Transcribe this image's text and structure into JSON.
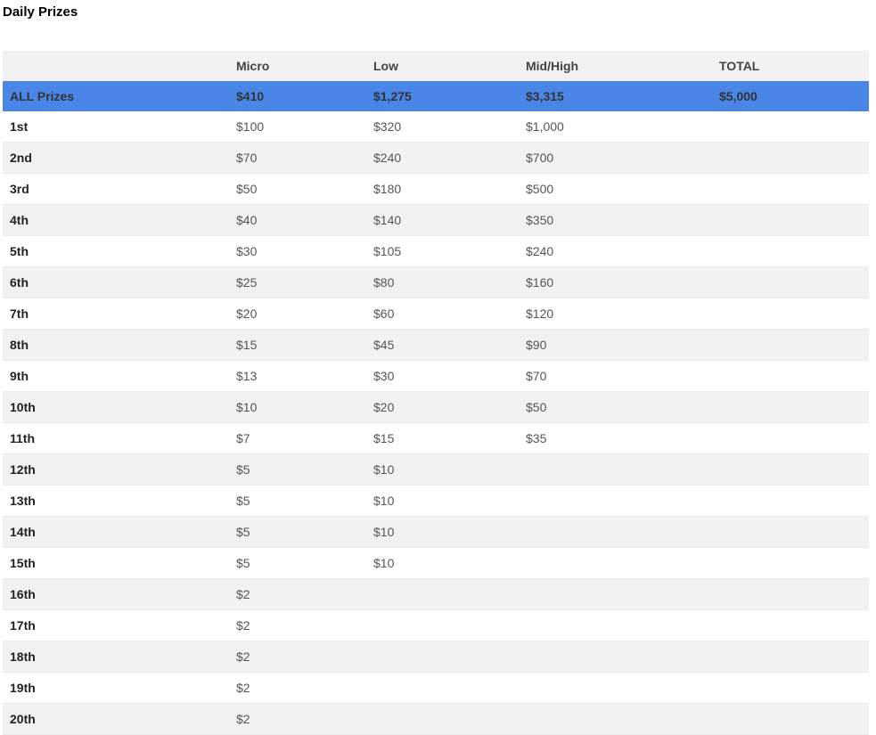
{
  "title": "Daily Prizes",
  "columns": [
    "",
    "Micro",
    "Low",
    "Mid/High",
    "TOTAL"
  ],
  "all_prizes": {
    "label": "ALL Prizes",
    "values": [
      "$410",
      "$1,275",
      "$3,315",
      "$5,000"
    ]
  },
  "rows": [
    {
      "place": "1st",
      "values": [
        "$100",
        "$320",
        "$1,000",
        ""
      ]
    },
    {
      "place": "2nd",
      "values": [
        "$70",
        "$240",
        "$700",
        ""
      ]
    },
    {
      "place": "3rd",
      "values": [
        "$50",
        "$180",
        "$500",
        ""
      ]
    },
    {
      "place": "4th",
      "values": [
        "$40",
        "$140",
        "$350",
        ""
      ]
    },
    {
      "place": "5th",
      "values": [
        "$30",
        "$105",
        "$240",
        ""
      ]
    },
    {
      "place": "6th",
      "values": [
        "$25",
        "$80",
        "$160",
        ""
      ]
    },
    {
      "place": "7th",
      "values": [
        "$20",
        "$60",
        "$120",
        ""
      ]
    },
    {
      "place": "8th",
      "values": [
        "$15",
        "$45",
        "$90",
        ""
      ]
    },
    {
      "place": "9th",
      "values": [
        "$13",
        "$30",
        "$70",
        ""
      ]
    },
    {
      "place": "10th",
      "values": [
        "$10",
        "$20",
        "$50",
        ""
      ]
    },
    {
      "place": "11th",
      "values": [
        "$7",
        "$15",
        "$35",
        ""
      ]
    },
    {
      "place": "12th",
      "values": [
        "$5",
        "$10",
        "",
        ""
      ]
    },
    {
      "place": "13th",
      "values": [
        "$5",
        "$10",
        "",
        ""
      ]
    },
    {
      "place": "14th",
      "values": [
        "$5",
        "$10",
        "",
        ""
      ]
    },
    {
      "place": "15th",
      "values": [
        "$5",
        "$10",
        "",
        ""
      ]
    },
    {
      "place": "16th",
      "values": [
        "$2",
        "",
        "",
        ""
      ]
    },
    {
      "place": "17th",
      "values": [
        "$2",
        "",
        "",
        ""
      ]
    },
    {
      "place": "18th",
      "values": [
        "$2",
        "",
        "",
        ""
      ]
    },
    {
      "place": "19th",
      "values": [
        "$2",
        "",
        "",
        ""
      ]
    },
    {
      "place": "20th",
      "values": [
        "$2",
        "",
        "",
        ""
      ]
    }
  ],
  "colors": {
    "highlight": "#4a86e8",
    "stripe": "#f2f2f2",
    "header_bg": "#f2f2f2"
  }
}
